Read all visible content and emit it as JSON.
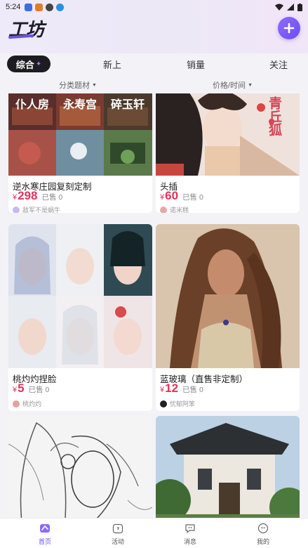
{
  "status_bar": {
    "time": "5:24"
  },
  "header": {
    "logo": "工坊"
  },
  "tabs": [
    {
      "label": "综合",
      "active": true
    },
    {
      "label": "新上",
      "active": false
    },
    {
      "label": "销量",
      "active": false
    },
    {
      "label": "关注",
      "active": false
    }
  ],
  "filters": {
    "category": "分类题材",
    "price_time": "价格/时间"
  },
  "products": [
    {
      "title": "逆水寒庄园复刻定制",
      "currency": "¥",
      "price": "298",
      "sold": "已售 0",
      "seller": "敌军不是蜗牛",
      "image_text": [
        "仆人房",
        "永寿宫",
        "碎玉轩"
      ]
    },
    {
      "title": "头插",
      "currency": "¥",
      "price": "60",
      "sold": "已售 0",
      "seller": "诺米糕",
      "image_text": [
        "青丘狐"
      ]
    },
    {
      "title": "桃灼灼捏脸",
      "currency": "¥",
      "price": "5",
      "sold": "已售 0",
      "seller": "桃灼灼",
      "image_text": []
    },
    {
      "title": "蓝玻璃（直售非定制）",
      "currency": "¥",
      "price": "12",
      "sold": "已售 0",
      "seller": "忧郁阿笨",
      "image_text": []
    },
    {
      "title": "",
      "currency": "",
      "price": "",
      "sold": "",
      "seller": "",
      "image_text": []
    },
    {
      "title": "",
      "currency": "",
      "price": "",
      "sold": "",
      "seller": "",
      "image_text": []
    }
  ],
  "bottom_nav": [
    {
      "label": "首页",
      "icon": "home-icon",
      "active": true
    },
    {
      "label": "活动",
      "icon": "activity-icon",
      "active": false
    },
    {
      "label": "消息",
      "icon": "message-icon",
      "active": false
    },
    {
      "label": "我的",
      "icon": "profile-icon",
      "active": false
    }
  ],
  "colors": {
    "accent": "#6a4ef3",
    "price": "#e5315a",
    "active_tab_bg": "#1c1c22"
  }
}
